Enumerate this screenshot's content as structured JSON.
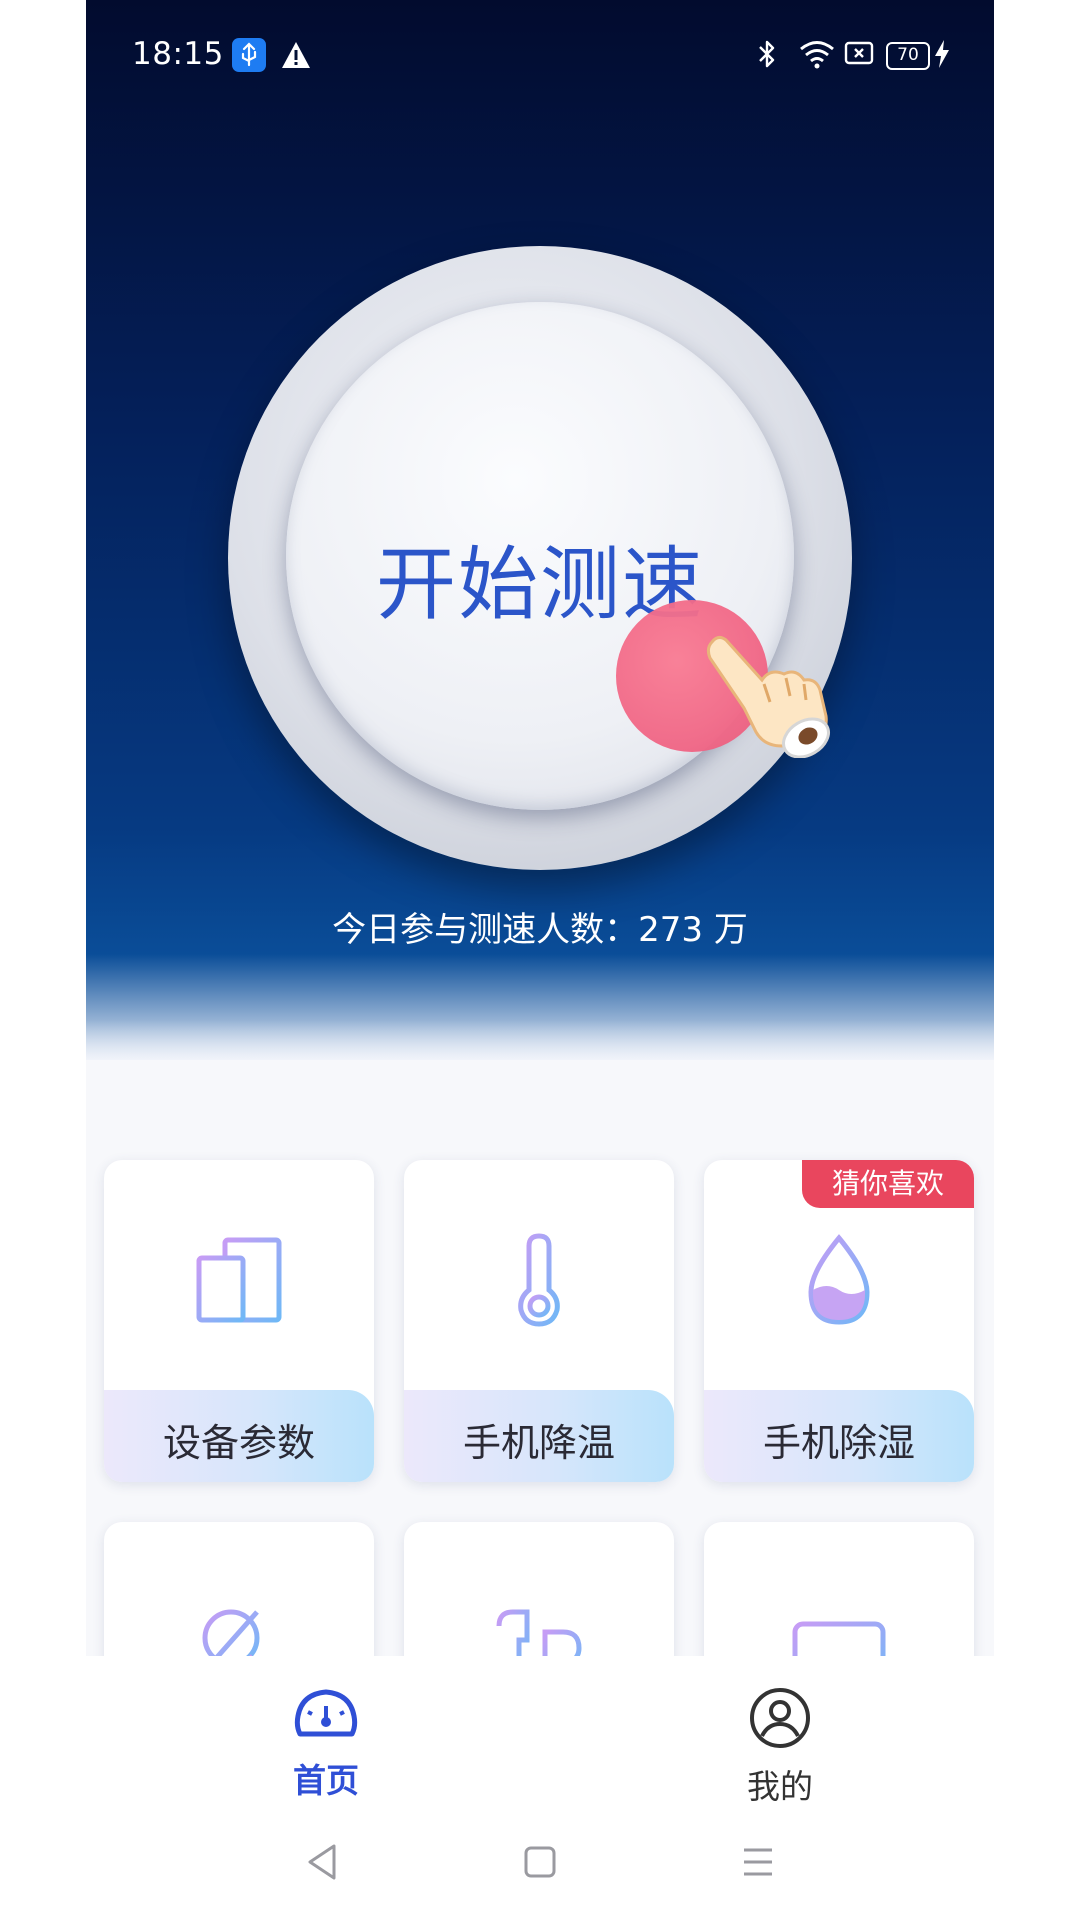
{
  "status_bar": {
    "time": "18:15",
    "icons": [
      "usb-debug-icon",
      "warning-icon",
      "bluetooth-icon",
      "wifi-icon",
      "sim-off-icon",
      "battery-icon",
      "charging-icon"
    ],
    "battery_level": "70"
  },
  "hero": {
    "start_button_label": "开始测速",
    "today_count_text": "今日参与测速人数：273 万",
    "colors": {
      "hero_top": "#020b2e",
      "hero_bottom": "#0a4d98",
      "start_label": "#2b55c9",
      "tap_dot": "#f06484"
    }
  },
  "features": [
    {
      "label": "设备参数",
      "icon": "device-icon",
      "badge": ""
    },
    {
      "label": "手机降温",
      "icon": "thermometer-icon",
      "badge": ""
    },
    {
      "label": "手机除湿",
      "icon": "water-drop-icon",
      "badge": "猜你喜欢"
    },
    {
      "label": "",
      "icon": "search-clean-icon",
      "badge": ""
    },
    {
      "label": "",
      "icon": "earbuds-icon",
      "badge": ""
    },
    {
      "label": "",
      "icon": "message-icon",
      "badge": ""
    }
  ],
  "bottom_nav": {
    "items": [
      {
        "label": "首页",
        "icon": "speedometer-icon",
        "active": true
      },
      {
        "label": "我的",
        "icon": "profile-icon",
        "active": false
      }
    ],
    "active_color": "#2f4fd6"
  },
  "system_nav": [
    "back-icon",
    "home-icon",
    "menu-icon"
  ]
}
